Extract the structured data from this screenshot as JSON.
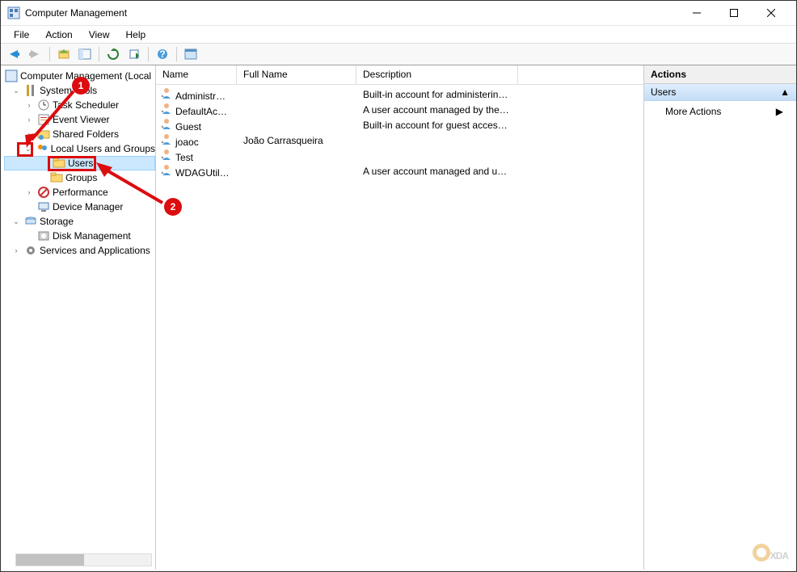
{
  "window": {
    "title": "Computer Management"
  },
  "menubar": [
    "File",
    "Action",
    "View",
    "Help"
  ],
  "toolbar_icons": [
    "back-arrow-icon",
    "forward-arrow-icon",
    "sep",
    "up-arrow-icon",
    "properties-icon",
    "sep",
    "refresh-icon",
    "export-icon",
    "sep",
    "help-icon",
    "sep",
    "view-icon"
  ],
  "tree": {
    "root": "Computer Management (Local",
    "system_tools": "System Tools",
    "task_scheduler": "Task Scheduler",
    "event_viewer": "Event Viewer",
    "shared_folders": "Shared Folders",
    "local_users_groups": "Local Users and Groups",
    "users": "Users",
    "groups": "Groups",
    "performance": "Performance",
    "device_manager": "Device Manager",
    "storage": "Storage",
    "disk_management": "Disk Management",
    "services_apps": "Services and Applications"
  },
  "list": {
    "columns": {
      "name": "Name",
      "fullname": "Full Name",
      "description": "Description"
    },
    "rows": [
      {
        "name": "Administrator",
        "fullname": "",
        "description": "Built-in account for administering..."
      },
      {
        "name": "DefaultAcco...",
        "fullname": "",
        "description": "A user account managed by the s..."
      },
      {
        "name": "Guest",
        "fullname": "",
        "description": "Built-in account for guest access t..."
      },
      {
        "name": "joaoc",
        "fullname": "João Carrasqueira",
        "description": ""
      },
      {
        "name": "Test",
        "fullname": "",
        "description": ""
      },
      {
        "name": "WDAGUtility...",
        "fullname": "",
        "description": "A user account managed and use..."
      }
    ]
  },
  "actions": {
    "header": "Actions",
    "section": "Users",
    "more": "More Actions"
  },
  "annotations": {
    "badge1": "1",
    "badge2": "2"
  },
  "watermark": "XDA"
}
